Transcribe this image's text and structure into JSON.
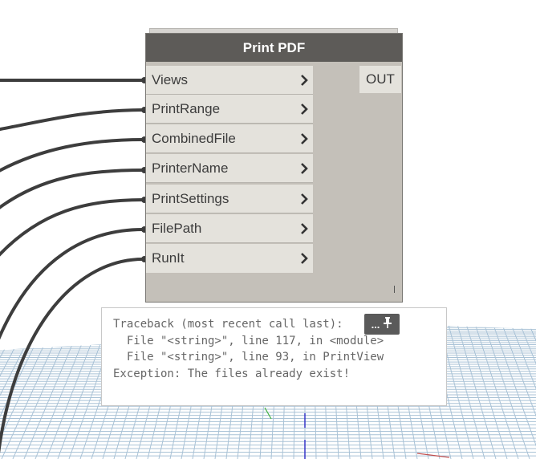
{
  "node": {
    "title": "Print PDF",
    "inputs": [
      {
        "label": "Views"
      },
      {
        "label": "PrintRange"
      },
      {
        "label": "CombinedFile"
      },
      {
        "label": "PrinterName"
      },
      {
        "label": "PrintSettings"
      },
      {
        "label": "FilePath"
      },
      {
        "label": "RunIt"
      }
    ],
    "output_label": "OUT",
    "colors": {
      "header": "#5d5b58",
      "body": "#c4c0b9",
      "port": "#e4e2dc",
      "wire": "#3d3d3d"
    }
  },
  "error": {
    "lines": [
      "Traceback (most recent call last):",
      "  File \"<string>\", line 117, in <module>",
      "  File \"<string>\", line 93, in PrintView",
      "Exception: The files already exist!"
    ],
    "button_dots": "...",
    "button_icon": "pin-icon"
  }
}
